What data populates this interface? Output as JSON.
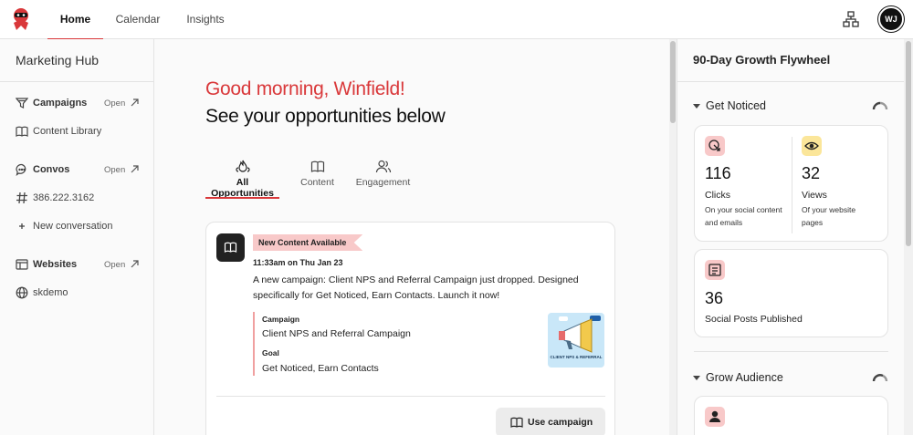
{
  "nav": {
    "tabs": [
      {
        "label": "Home"
      },
      {
        "label": "Calendar"
      },
      {
        "label": "Insights"
      }
    ],
    "avatar_initials": "WJ"
  },
  "sidebar": {
    "title": "Marketing Hub",
    "campaigns": {
      "label": "Campaigns",
      "open": "Open"
    },
    "content_library": "Content Library",
    "convos": {
      "label": "Convos",
      "open": "Open"
    },
    "phone": "386.222.3162",
    "new_conversation": "New conversation",
    "websites": {
      "label": "Websites",
      "open": "Open"
    },
    "site": "skdemo"
  },
  "main": {
    "greeting": "Good morning, Winfield!",
    "subheading": "See your opportunities below",
    "tabs": [
      {
        "label": "All Opportunities"
      },
      {
        "label": "Content"
      },
      {
        "label": "Engagement"
      }
    ],
    "card": {
      "badge": "New Content Available",
      "time": "11:33am on Thu Jan 23",
      "description": "A new campaign: Client NPS and Referral Campaign just dropped. Designed specifically for Get Noticed, Earn Contacts. Launch it now!",
      "campaign_label": "Campaign",
      "campaign_value": "Client NPS and Referral Campaign",
      "goal_label": "Goal",
      "goal_value": "Get Noticed, Earn Contacts",
      "thumbnail_text": "CLIENT NPS & REFERRAL",
      "button": "Use campaign"
    }
  },
  "right": {
    "title": "90-Day Growth Flywheel",
    "section1": "Get Noticed",
    "clicks": {
      "value": "116",
      "label": "Clicks",
      "sub": "On your social content and emails"
    },
    "views": {
      "value": "32",
      "label": "Views",
      "sub": "Of your website pages"
    },
    "posts": {
      "value": "36",
      "label": "Social Posts Published"
    },
    "section2": "Grow Audience"
  },
  "colors": {
    "accent": "#d9383a",
    "badge_bg": "#f8c9c9",
    "views_icon_bg": "#fbe69a"
  }
}
